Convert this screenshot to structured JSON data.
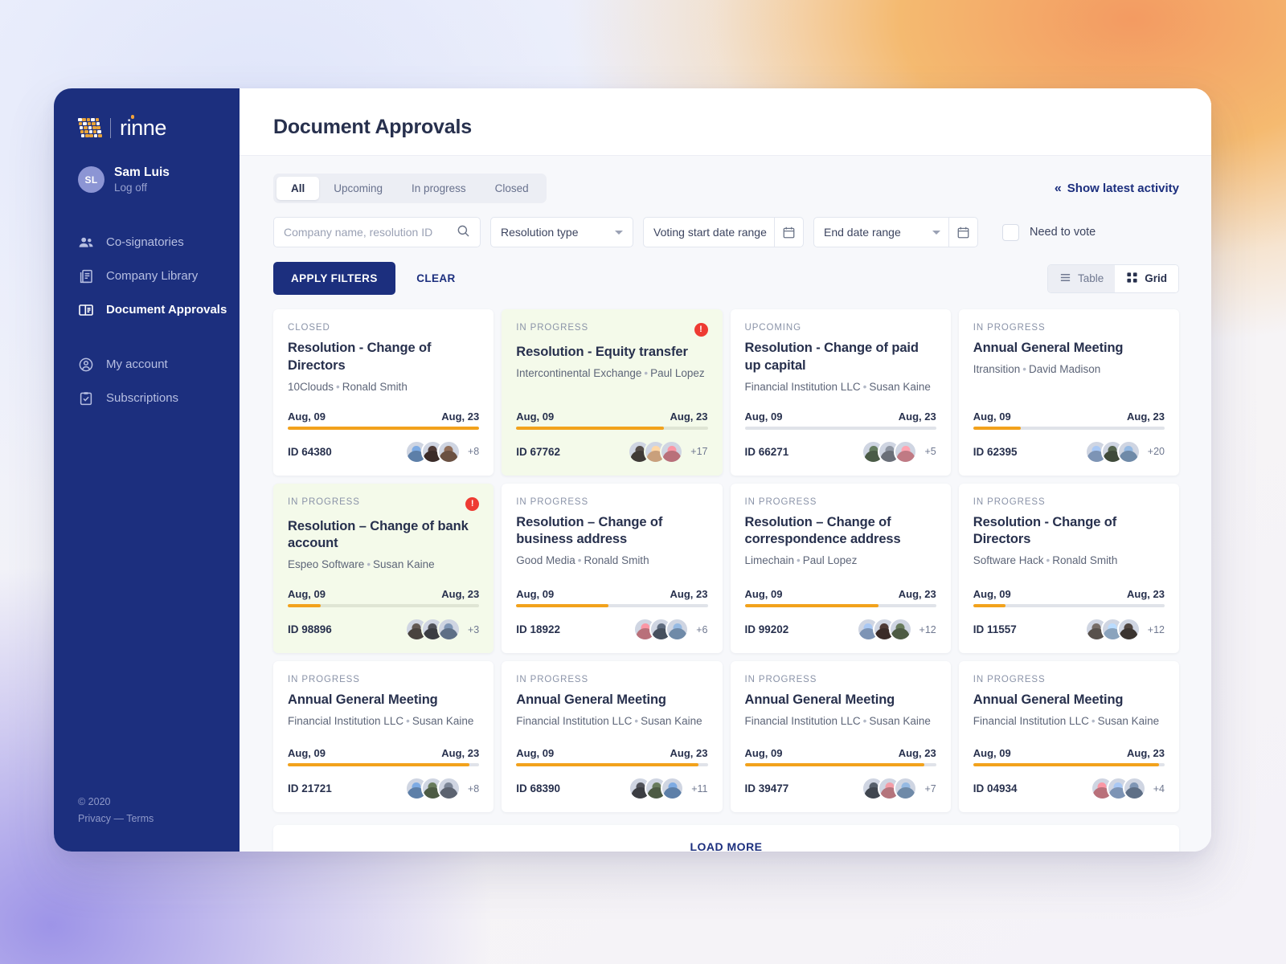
{
  "app": {
    "logo_text": "rinne",
    "accent_orange": "#f2a21c",
    "brand_navy": "#1c2f7e",
    "alert_red": "#ee3b33",
    "highlight_green": "#f4faea"
  },
  "sidebar": {
    "user": {
      "initials": "SL",
      "name": "Sam Luis",
      "logoff": "Log off"
    },
    "items": [
      {
        "label": "Co-signatories",
        "icon": "people-icon",
        "active": false
      },
      {
        "label": "Company Library",
        "icon": "library-icon",
        "active": false
      },
      {
        "label": "Document Approvals",
        "icon": "document-approvals-icon",
        "active": true
      },
      {
        "label": "My account",
        "icon": "user-circle-icon",
        "active": false
      },
      {
        "label": "Subscriptions",
        "icon": "checklist-icon",
        "active": false
      }
    ],
    "footer": {
      "copyright": "© 2020",
      "privacy": "Privacy",
      "dash": "—",
      "terms": "Terms"
    }
  },
  "header": {
    "title": "Document Approvals"
  },
  "filters": {
    "tabs": [
      {
        "label": "All",
        "active": true
      },
      {
        "label": "Upcoming",
        "active": false
      },
      {
        "label": "In progress",
        "active": false
      },
      {
        "label": "Closed",
        "active": false
      }
    ],
    "latest_activity": "Show latest activity",
    "latest_activity_chevron": "«",
    "search": {
      "placeholder": "Company name, resolution ID",
      "value": "",
      "icon": "search-icon"
    },
    "resolution_type": {
      "label": "Resolution type",
      "icon": "chevron-down-icon"
    },
    "voting_start": {
      "label": "Voting start date range",
      "icon": "calendar-icon"
    },
    "end_date": {
      "label": "End date range",
      "icon": "calendar-icon"
    },
    "need_to_vote": {
      "label": "Need to vote",
      "checked": false
    },
    "apply_label": "APPLY FILTERS",
    "clear_label": "CLEAR",
    "view": {
      "table": {
        "label": "Table",
        "icon": "list-icon",
        "active": false
      },
      "grid": {
        "label": "Grid",
        "icon": "grid-icon",
        "active": true
      }
    }
  },
  "cards": [
    {
      "status": "CLOSED",
      "title": "Resolution - Change of Directors",
      "company": "10Clouds",
      "person": "Ronald Smith",
      "start": "Aug, 09",
      "end": "Aug, 23",
      "progress": 100,
      "id": "ID 64380",
      "more": "+8",
      "alert": false,
      "highlight": false,
      "avatars": [
        "#5d7fa8",
        "#3a2b28",
        "#6b5142"
      ]
    },
    {
      "status": "IN PROGRESS",
      "title": "Resolution - Equity transfer",
      "company": "Intercontinental Exchange",
      "person": "Paul Lopez",
      "start": "Aug, 09",
      "end": "Aug, 23",
      "progress": 77,
      "id": "ID 67762",
      "more": "+17",
      "alert": true,
      "highlight": true,
      "avatars": [
        "#3f3a36",
        "#c9a07c",
        "#b9707a"
      ]
    },
    {
      "status": "UPCOMING",
      "title": "Resolution - Change of paid up capital",
      "company": "Financial Institution LLC",
      "person": "Susan Kaine",
      "start": "Aug, 09",
      "end": "Aug, 23",
      "progress": 0,
      "id": "ID 66271",
      "more": "+5",
      "alert": false,
      "highlight": false,
      "avatars": [
        "#4a5b46",
        "#6a6f78",
        "#c07a84"
      ]
    },
    {
      "status": "IN PROGRESS",
      "title": "Annual General Meeting",
      "company": "Itransition",
      "person": "David Madison",
      "start": "Aug, 09",
      "end": "Aug, 23",
      "progress": 25,
      "id": "ID 62395",
      "more": "+20",
      "alert": false,
      "highlight": false,
      "avatars": [
        "#7d94b5",
        "#3f4a3a",
        "#6f8aa8"
      ]
    },
    {
      "status": "IN PROGRESS",
      "title": "Resolution – Change of bank account",
      "company": "Espeo Software",
      "person": "Susan Kaine",
      "start": "Aug, 09",
      "end": "Aug, 23",
      "progress": 17,
      "id": "ID 98896",
      "more": "+3",
      "alert": true,
      "highlight": true,
      "avatars": [
        "#49433f",
        "#3b3d42",
        "#5e6f86"
      ]
    },
    {
      "status": "IN PROGRESS",
      "title": "Resolution – Change of business address",
      "company": "Good Media",
      "person": "Ronald Smith",
      "start": "Aug, 09",
      "end": "Aug, 23",
      "progress": 48,
      "id": "ID 18922",
      "more": "+6",
      "alert": false,
      "highlight": false,
      "avatars": [
        "#b9707a",
        "#46505e",
        "#6f8aa8"
      ]
    },
    {
      "status": "IN PROGRESS",
      "title": "Resolution – Change of correspondence address",
      "company": "Limechain",
      "person": "Paul Lopez",
      "start": "Aug, 09",
      "end": "Aug, 23",
      "progress": 70,
      "id": "ID 99202",
      "more": "+12",
      "alert": false,
      "highlight": false,
      "avatars": [
        "#7d94b5",
        "#3a2b28",
        "#4d5b44"
      ]
    },
    {
      "status": "IN PROGRESS",
      "title": "Resolution - Change of Directors",
      "company": "Software Hack",
      "person": "Ronald Smith",
      "start": "Aug, 09",
      "end": "Aug, 23",
      "progress": 17,
      "id": "ID 11557",
      "more": "+12",
      "alert": false,
      "highlight": false,
      "avatars": [
        "#58514c",
        "#8aa3bd",
        "#3b3430"
      ]
    },
    {
      "status": "IN PROGRESS",
      "title": "Annual General Meeting",
      "company": "Financial Institution LLC",
      "person": "Susan Kaine",
      "start": "Aug, 09",
      "end": "Aug, 23",
      "progress": 95,
      "id": "ID 21721",
      "more": "+8",
      "alert": false,
      "highlight": false,
      "avatars": [
        "#5d7fa8",
        "#4d5b44",
        "#5c6370"
      ]
    },
    {
      "status": "IN PROGRESS",
      "title": "Annual General Meeting",
      "company": "Financial Institution LLC",
      "person": "Susan Kaine",
      "start": "Aug, 09",
      "end": "Aug, 23",
      "progress": 95,
      "id": "ID 68390",
      "more": "+11",
      "alert": false,
      "highlight": false,
      "avatars": [
        "#3b3d42",
        "#4d5b44",
        "#5d7fa8"
      ]
    },
    {
      "status": "IN PROGRESS",
      "title": "Annual General Meeting",
      "company": "Financial Institution LLC",
      "person": "Susan Kaine",
      "start": "Aug, 09",
      "end": "Aug, 23",
      "progress": 94,
      "id": "ID 39477",
      "more": "+7",
      "alert": false,
      "highlight": false,
      "avatars": [
        "#40464f",
        "#b4747c",
        "#6f8aa8"
      ]
    },
    {
      "status": "IN PROGRESS",
      "title": "Annual General Meeting",
      "company": "Financial Institution LLC",
      "person": "Susan Kaine",
      "start": "Aug, 09",
      "end": "Aug, 23",
      "progress": 97,
      "id": "ID 04934",
      "more": "+4",
      "alert": false,
      "highlight": false,
      "avatars": [
        "#b9707a",
        "#7d94b5",
        "#5e6f86"
      ]
    }
  ],
  "load_more": "LOAD MORE"
}
